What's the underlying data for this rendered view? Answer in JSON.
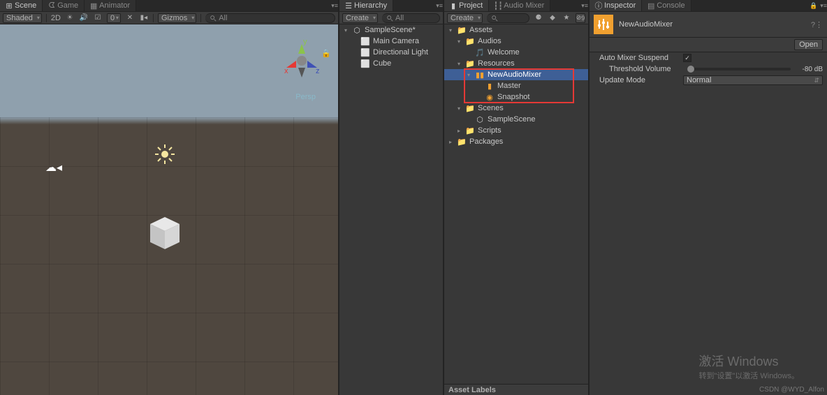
{
  "scene_panel": {
    "tabs": [
      {
        "label": "Scene",
        "icon": "grid"
      },
      {
        "label": "Game",
        "icon": "pac"
      },
      {
        "label": "Animator",
        "icon": "anim"
      }
    ],
    "shading_mode": "Shaded",
    "render_mode": "2D",
    "gizmos_label": "Gizmos",
    "search_placeholder": "All",
    "persp_label": "Persp"
  },
  "hierarchy_panel": {
    "tab": "Hierarchy",
    "create_label": "Create",
    "search_placeholder": "All",
    "items": [
      {
        "label": "SampleScene*",
        "icon": "unity",
        "depth": 0,
        "arrow": "▾"
      },
      {
        "label": "Main Camera",
        "icon": "go",
        "depth": 1
      },
      {
        "label": "Directional Light",
        "icon": "go",
        "depth": 1
      },
      {
        "label": "Cube",
        "icon": "go",
        "depth": 1
      }
    ]
  },
  "project_panel": {
    "tabs": [
      {
        "label": "Project",
        "active": true
      },
      {
        "label": "Audio Mixer",
        "active": false
      }
    ],
    "create_label": "Create",
    "filter_badge": "9",
    "items": [
      {
        "label": "Assets",
        "icon": "folder",
        "depth": 0,
        "arrow": "▾"
      },
      {
        "label": "Audios",
        "icon": "folder",
        "depth": 1,
        "arrow": "▾"
      },
      {
        "label": "Welcome",
        "icon": "audio",
        "depth": 2
      },
      {
        "label": "Resources",
        "icon": "folder",
        "depth": 1,
        "arrow": "▾"
      },
      {
        "label": "NewAudioMixer",
        "icon": "mixer",
        "depth": 2,
        "arrow": "▾",
        "sel": true
      },
      {
        "label": "Master",
        "icon": "mixgrp",
        "depth": 3
      },
      {
        "label": "Snapshot",
        "icon": "snap",
        "depth": 3
      },
      {
        "label": "Scenes",
        "icon": "folder",
        "depth": 1,
        "arrow": "▾"
      },
      {
        "label": "SampleScene",
        "icon": "unity",
        "depth": 2
      },
      {
        "label": "Scripts",
        "icon": "folder",
        "depth": 1,
        "arrow": "▸"
      },
      {
        "label": "Packages",
        "icon": "folder",
        "depth": 0,
        "arrow": "▸"
      }
    ],
    "asset_labels": "Asset Labels"
  },
  "inspector_panel": {
    "tabs": [
      {
        "label": "Inspector",
        "icon": "info"
      },
      {
        "label": "Console",
        "icon": "console"
      }
    ],
    "asset_name": "NewAudioMixer",
    "open_btn": "Open",
    "props": {
      "auto_suspend_label": "Auto Mixer Suspend",
      "auto_suspend_checked": true,
      "threshold_label": "Threshold Volume",
      "threshold_value": "-80 dB",
      "update_mode_label": "Update Mode",
      "update_mode_value": "Normal"
    }
  },
  "watermark": {
    "title": "激活 Windows",
    "sub": "转到\"设置\"以激活 Windows。",
    "credit": "CSDN @WYD_Alfon"
  }
}
